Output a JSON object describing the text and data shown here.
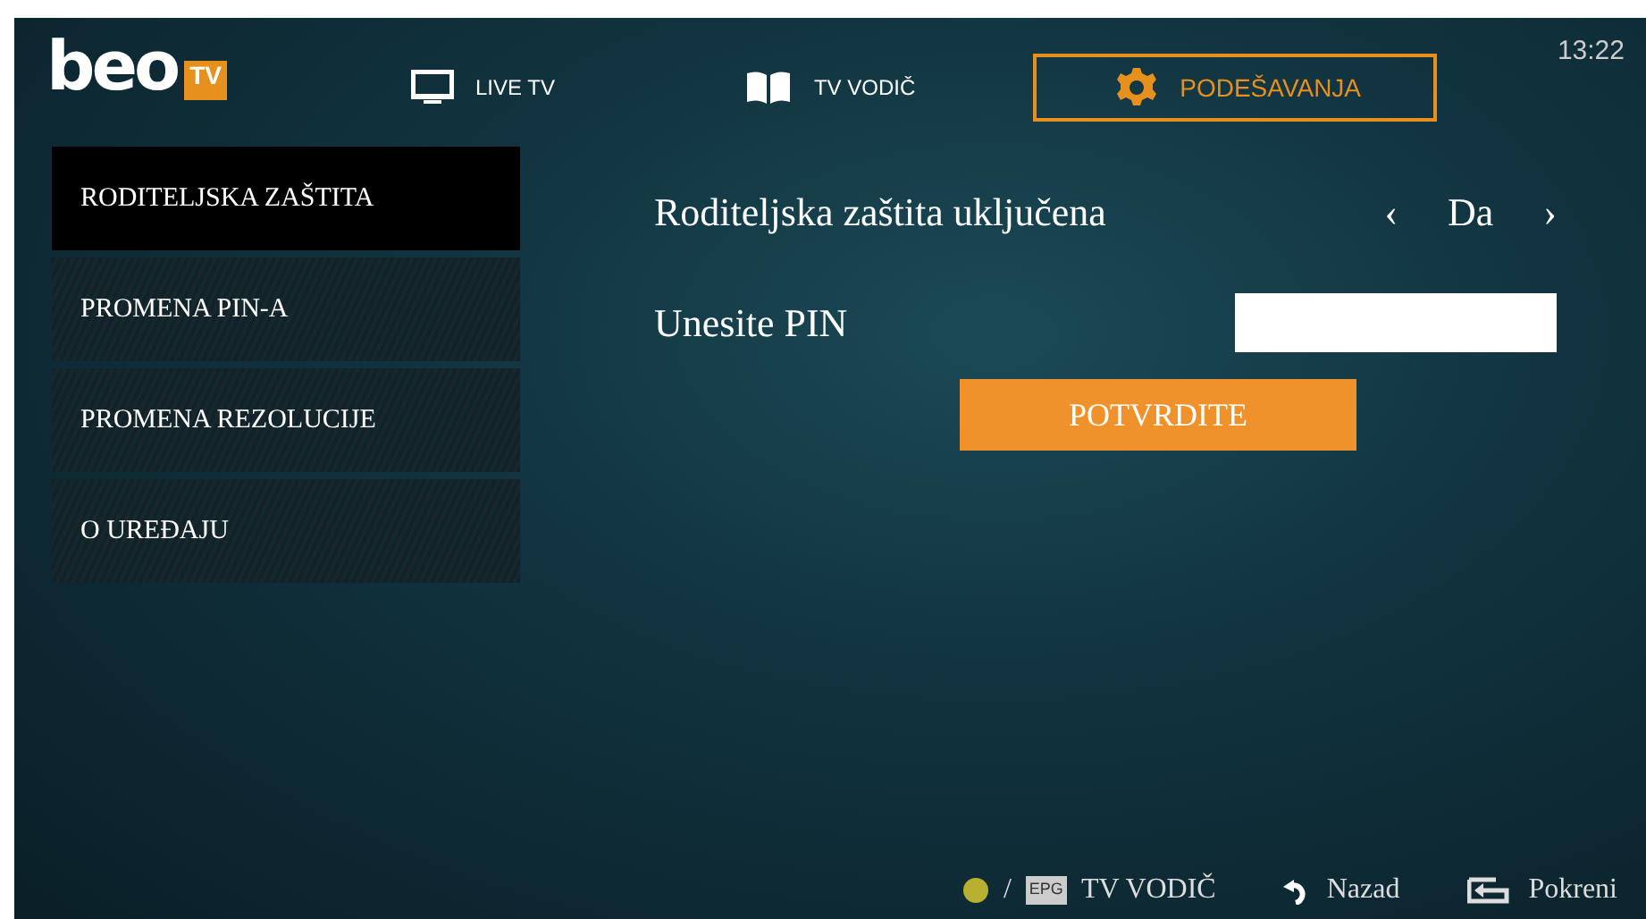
{
  "logo": {
    "text": "beo",
    "badge": "TV"
  },
  "nav": [
    {
      "label": "LIVE TV",
      "kind": "tv",
      "selected": false
    },
    {
      "label": "TV VODIČ",
      "kind": "book",
      "selected": false
    },
    {
      "label": "PODEŠAVANJA",
      "kind": "gear",
      "selected": true
    }
  ],
  "clock": "13:22",
  "sidebar": {
    "items": [
      {
        "label": "RODITELJSKA ZAŠTITA",
        "selected": true
      },
      {
        "label": "PROMENA PIN-A",
        "selected": false
      },
      {
        "label": "PROMENA REZOLUCIJE",
        "selected": false
      },
      {
        "label": "O UREĐAJU",
        "selected": false
      }
    ]
  },
  "settings": [
    {
      "kind": "selector",
      "label": "Roditeljska zaštita uključena",
      "value": "Da",
      "prev": "‹",
      "next": "›"
    },
    {
      "kind": "input",
      "label": "Unesite PIN"
    }
  ],
  "confirm_button": "POTVRDITE",
  "footer": [
    {
      "kind": "dot-epg",
      "sep": "/",
      "key": "EPG",
      "label": "TV VODIČ"
    },
    {
      "kind": "back",
      "label": "Nazad"
    },
    {
      "kind": "enter",
      "label": "Pokreni"
    }
  ]
}
